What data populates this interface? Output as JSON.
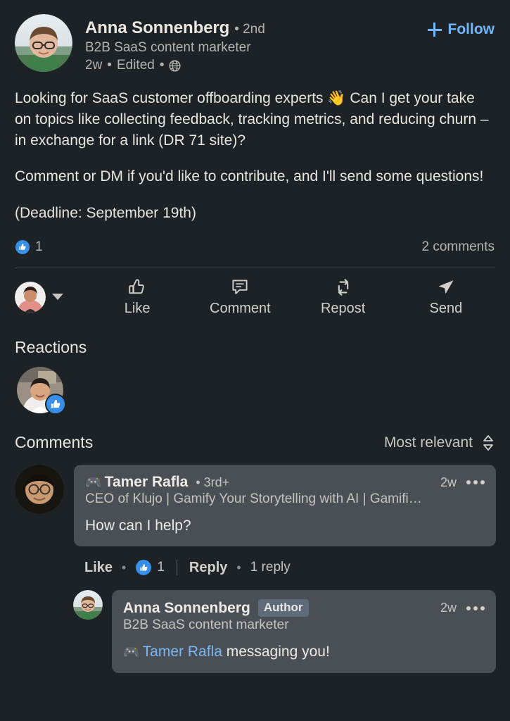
{
  "theme": {
    "background": "#1d2226",
    "text_primary": "#e9e5df",
    "text_secondary": "#b6b3ae",
    "link_blue": "#71b7fb",
    "like_blue": "#378fe9",
    "bubble_bg": "#4a4f55",
    "badge_bg": "#5f6b7a"
  },
  "post": {
    "author_name": "Anna Sonnenberg",
    "degree": "• 2nd",
    "author_title": "B2B SaaS content marketer",
    "timestamp": "2w",
    "edited_label": "Edited",
    "separator": "•",
    "visibility_icon": "globe-icon",
    "follow_label": "Follow",
    "follow_icon": "plus-icon",
    "body": [
      "Looking for SaaS customer offboarding experts 👋 Can I get your take on topics like collecting feedback, tracking metrics, and reducing churn – in exchange for a link (DR 71 site)?",
      "Comment or DM if you'd like to contribute, and I'll send some questions!",
      "(Deadline: September 19th)"
    ]
  },
  "social_counts": {
    "reaction_icon": "thumbs-up-badge-icon",
    "reaction_count": "1",
    "comments_count": "2 comments"
  },
  "actions": {
    "actor_picker_icon": "chevron-down-icon",
    "buttons": [
      {
        "label": "Like",
        "icon": "thumbs-up-icon"
      },
      {
        "label": "Comment",
        "icon": "speech-bubble-icon"
      },
      {
        "label": "Repost",
        "icon": "repost-icon"
      },
      {
        "label": "Send",
        "icon": "paper-plane-icon"
      }
    ]
  },
  "reactions": {
    "title": "Reactions",
    "badge_icon": "thumbs-up-badge-icon"
  },
  "comments_section": {
    "title": "Comments",
    "sort_label": "Most relevant",
    "sort_icon": "sort-updown-icon",
    "comments": [
      {
        "emoji": "🎮",
        "name": "Tamer Rafla",
        "degree": "• 3rd+",
        "title": "CEO of Klujo | Gamify Your Storytelling with AI | Gamifi…",
        "time": "2w",
        "more_icon": "more-horizontal-icon",
        "text": "How can I help?",
        "actions": {
          "like_label": "Like",
          "dot": "•",
          "like_icon": "thumbs-up-badge-icon",
          "like_count": "1",
          "reply_label": "Reply",
          "replies_label": "1 reply"
        }
      },
      {
        "emoji": "",
        "name": "Anna Sonnenberg",
        "badge": "Author",
        "title": "B2B SaaS content marketer",
        "time": "2w",
        "more_icon": "more-horizontal-icon",
        "mention_emoji": "🎮",
        "mention": "Tamer Rafla",
        "text_after_mention": " messaging you!"
      }
    ]
  }
}
